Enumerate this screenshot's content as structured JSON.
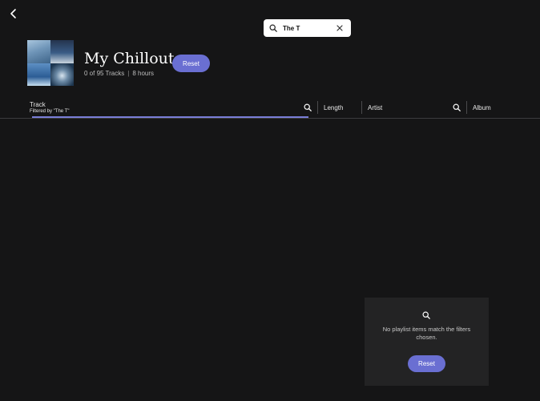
{
  "icons": {
    "back": "chevron-left-icon",
    "search": "search-icon",
    "clear": "close-icon"
  },
  "colors": {
    "background": "#151516",
    "accent": "#6a6fd2",
    "card": "#232324"
  },
  "search": {
    "value": "The T",
    "placeholder": ""
  },
  "playlist": {
    "title": "My Chillout",
    "track_count": "0 of 95 Tracks",
    "separator": "|",
    "duration": "8 hours",
    "reset_label": "Reset"
  },
  "columns": {
    "track": {
      "label": "Track",
      "filter_note": "Filtered by \"The T\""
    },
    "length": {
      "label": "Length"
    },
    "artist": {
      "label": "Artist"
    },
    "album": {
      "label": "Album"
    }
  },
  "empty_state": {
    "message": "No playlist items match the filters chosen.",
    "reset_label": "Reset"
  }
}
